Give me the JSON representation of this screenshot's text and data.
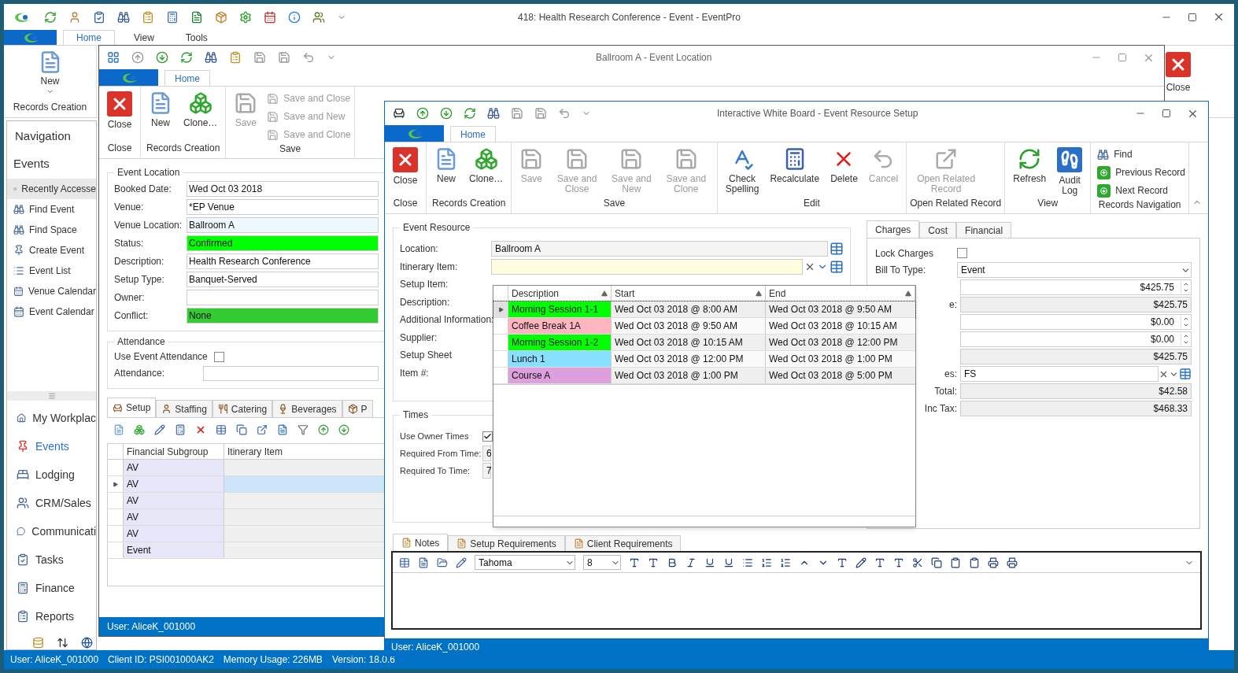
{
  "main_window": {
    "title": "418: Health Research Conference - Event - EventPro",
    "tabs": [
      {
        "label": "Home",
        "selected": true
      },
      {
        "label": "View",
        "selected": false
      },
      {
        "label": "Tools",
        "selected": false
      }
    ],
    "ribbon": {
      "new_label": "New",
      "group_label": "Records Creation",
      "close_label": "Close"
    },
    "navigation": {
      "title": "Navigation",
      "section": "Events",
      "items": [
        {
          "label": "Recently Accesse",
          "selected": true
        },
        {
          "label": "Find Event",
          "selected": false
        },
        {
          "label": "Find Space",
          "selected": false
        },
        {
          "label": "Create Event",
          "selected": false
        },
        {
          "label": "Event List",
          "selected": false
        },
        {
          "label": "Venue Calendar",
          "selected": false
        },
        {
          "label": "Event Calendar",
          "selected": false
        }
      ],
      "modules": [
        {
          "label": "My Workplac",
          "selected": false
        },
        {
          "label": "Events",
          "selected": true
        },
        {
          "label": "Lodging",
          "selected": false
        },
        {
          "label": "CRM/Sales",
          "selected": false
        },
        {
          "label": "Communicati",
          "selected": false
        },
        {
          "label": "Tasks",
          "selected": false
        },
        {
          "label": "Finance",
          "selected": false
        },
        {
          "label": "Reports",
          "selected": false
        }
      ]
    },
    "status_bar": [
      "User: AliceK_001000",
      "Client ID: PSI001000AK2",
      "Memory Usage: 226MB",
      "Version: 18.0.6"
    ]
  },
  "location_window": {
    "title": "Ballroom A - Event Location",
    "tabs": [
      {
        "label": "Home",
        "selected": true
      }
    ],
    "ribbon_groups": [
      {
        "label": "Close",
        "buttons": [
          {
            "label": "Close",
            "kind": "large",
            "disabled": false
          }
        ]
      },
      {
        "label": "Records Creation",
        "buttons": [
          {
            "label": "New",
            "kind": "large",
            "disabled": false
          },
          {
            "label": "Clone…",
            "kind": "large",
            "disabled": false
          }
        ]
      },
      {
        "label": "Save",
        "buttons": [
          {
            "label": "Save",
            "kind": "large",
            "disabled": true
          },
          {
            "label": "Save and Close",
            "kind": "small",
            "disabled": true
          },
          {
            "label": "Save and New",
            "kind": "small",
            "disabled": true
          },
          {
            "label": "Save and Clone",
            "kind": "small",
            "disabled": true
          }
        ]
      }
    ],
    "event_location": {
      "title": "Event Location",
      "fields": [
        {
          "label": "Booked Date:",
          "value": "Wed Oct 03 2018",
          "color": "#ffffff"
        },
        {
          "label": "Venue:",
          "value": "*EP Venue",
          "color": "#ffffff"
        },
        {
          "label": "Venue Location:",
          "value": "Ballroom A",
          "color": "#f0f8ff"
        },
        {
          "label": "Status:",
          "value": "Confirmed",
          "color": "#00ff00"
        },
        {
          "label": "Description:",
          "value": "Health Research Conference",
          "color": "#ffffff"
        },
        {
          "label": "Setup Type:",
          "value": "Banquet-Served",
          "color": "#ffffff"
        },
        {
          "label": "Owner:",
          "color": "#ffffff"
        },
        {
          "label": "Conflict:",
          "value": "None",
          "color": "#33cc33"
        }
      ]
    },
    "attendance": {
      "title": "Attendance",
      "use_label": "Use Event Attendance",
      "checked": false,
      "attendance_label": "Attendance:"
    },
    "detail_tabs": [
      {
        "label": "Setup",
        "selected": true
      },
      {
        "label": "Staffing",
        "selected": false
      },
      {
        "label": "Catering",
        "selected": false
      },
      {
        "label": "Beverages",
        "selected": false
      },
      {
        "label": "P",
        "selected": false
      }
    ],
    "grid": {
      "columns": [
        "Financial Subgroup",
        "Itinerary Item"
      ],
      "rows": [
        {
          "subgroup": "AV",
          "current": false
        },
        {
          "subgroup": "AV",
          "current": true
        },
        {
          "subgroup": "AV",
          "current": false
        },
        {
          "subgroup": "AV",
          "current": false
        },
        {
          "subgroup": "AV",
          "current": false
        },
        {
          "subgroup": "Event",
          "current": false
        }
      ]
    },
    "status": "User: AliceK_001000"
  },
  "resource_window": {
    "title": "Interactive White Board - Event Resource Setup",
    "tabs": [
      {
        "label": "Home",
        "selected": true
      }
    ],
    "ribbon_groups": [
      {
        "label": "Close",
        "buttons": [
          {
            "label": "Close",
            "kind": "large",
            "disabled": false
          }
        ]
      },
      {
        "label": "Records Creation",
        "buttons": [
          {
            "label": "New",
            "kind": "large",
            "disabled": false
          },
          {
            "label": "Clone…",
            "kind": "large",
            "disabled": false
          }
        ]
      },
      {
        "label": "Save",
        "buttons": [
          {
            "label": "Save",
            "kind": "large",
            "disabled": true
          },
          {
            "label": "Save and Close",
            "kind": "large",
            "disabled": true
          },
          {
            "label": "Save and New",
            "kind": "large",
            "disabled": true
          },
          {
            "label": "Save and Clone",
            "kind": "large",
            "disabled": true
          }
        ]
      },
      {
        "label": "Edit",
        "buttons": [
          {
            "label": "Check Spelling",
            "kind": "large",
            "disabled": false
          },
          {
            "label": "Recalculate",
            "kind": "large",
            "disabled": false
          },
          {
            "label": "Delete",
            "kind": "large",
            "disabled": false
          },
          {
            "label": "Cancel",
            "kind": "large",
            "disabled": true
          }
        ]
      },
      {
        "label": "Open Related Record",
        "buttons": [
          {
            "label": "Open Related Record",
            "kind": "large",
            "disabled": true
          }
        ]
      },
      {
        "label": "View",
        "buttons": [
          {
            "label": "Refresh",
            "kind": "large",
            "disabled": false
          },
          {
            "label": "Audit Log",
            "kind": "large",
            "disabled": false
          }
        ]
      },
      {
        "label": "Records Navigation",
        "buttons": [
          {
            "label": "Find",
            "kind": "small",
            "disabled": false
          },
          {
            "label": "Previous Record",
            "kind": "small",
            "disabled": false
          },
          {
            "label": "Next Record",
            "kind": "small",
            "disabled": false
          }
        ]
      }
    ],
    "event_resource": {
      "title": "Event Resource",
      "location_label": "Location:",
      "location_value": "Ballroom A",
      "itinerary_label": "Itinerary Item:",
      "other_labels": [
        "Setup Item:",
        "Description:",
        "Additional Information:",
        "Supplier:",
        "Setup Sheet",
        "Item #:"
      ]
    },
    "times": {
      "title": "Times",
      "use_owner_label": "Use Owner Times",
      "use_owner_checked": true,
      "from_label": "Required From Time:",
      "from_value": "6",
      "to_label": "Required To Time:",
      "to_value": "7"
    },
    "itinerary_dropdown": {
      "columns": [
        "Description",
        "Start",
        "End"
      ],
      "rows": [
        {
          "description": "Morning Session 1-1",
          "start": "Wed Oct 03 2018 @ 8:00 AM",
          "end": "Wed Oct 03 2018 @ 9:50 AM",
          "color": "#00ff00",
          "current": true
        },
        {
          "description": "Coffee Break 1A",
          "start": "Wed Oct 03 2018 @ 9:50 AM",
          "end": "Wed Oct 03 2018 @ 10:15 AM",
          "color": "#ffb6c1",
          "current": false
        },
        {
          "description": "Morning Session 1-2",
          "start": "Wed Oct 03 2018 @ 10:15 AM",
          "end": "Wed Oct 03 2018 @ 12:00 PM",
          "color": "#00ff00",
          "current": false
        },
        {
          "description": "Lunch 1",
          "start": "Wed Oct 03 2018 @ 12:00 PM",
          "end": "Wed Oct 03 2018 @ 1:00 PM",
          "color": "#87e0ff",
          "current": false
        },
        {
          "description": "Course A",
          "start": "Wed Oct 03 2018 @ 1:00 PM",
          "end": "Wed Oct 03 2018 @ 5:00 PM",
          "color": "#dda0dd",
          "current": false
        }
      ]
    },
    "charge_tabs": [
      {
        "label": "Charges",
        "selected": true
      },
      {
        "label": "Cost",
        "selected": false
      },
      {
        "label": "Financial",
        "selected": false
      }
    ],
    "charges": {
      "lock_label": "Lock Charges",
      "lock_checked": false,
      "bill_to_label": "Bill To Type:",
      "bill_to_value": "Event",
      "rows": [
        {
          "kind": "spin",
          "value": "$425.75"
        },
        {
          "kind": "readonly",
          "label": "e:",
          "value": "$425.75"
        },
        {
          "kind": "spin",
          "value": "$0.00"
        },
        {
          "kind": "spin",
          "value": "$0.00"
        },
        {
          "kind": "readonly",
          "value": "$425.75"
        },
        {
          "kind": "combo",
          "label": "es:",
          "value": "FS"
        },
        {
          "kind": "readonly",
          "label": "Total:",
          "value": "$42.58"
        },
        {
          "kind": "readonly",
          "label": "Inc Tax:",
          "value": "$468.33"
        }
      ]
    },
    "note_tabs": [
      {
        "label": "Notes",
        "selected": true
      },
      {
        "label": "Setup Requirements",
        "selected": false
      },
      {
        "label": "Client Requirements",
        "selected": false
      }
    ],
    "editor": {
      "font": "Tahoma",
      "size": "8"
    },
    "status": "User: AliceK_001000"
  }
}
